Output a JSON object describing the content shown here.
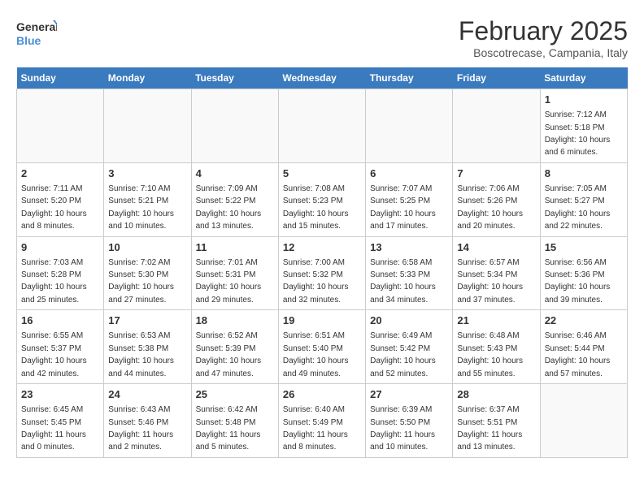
{
  "header": {
    "logo_line1": "General",
    "logo_line2": "Blue",
    "month": "February 2025",
    "location": "Boscotrecase, Campania, Italy"
  },
  "days_of_week": [
    "Sunday",
    "Monday",
    "Tuesday",
    "Wednesday",
    "Thursday",
    "Friday",
    "Saturday"
  ],
  "weeks": [
    [
      {
        "day": "",
        "info": ""
      },
      {
        "day": "",
        "info": ""
      },
      {
        "day": "",
        "info": ""
      },
      {
        "day": "",
        "info": ""
      },
      {
        "day": "",
        "info": ""
      },
      {
        "day": "",
        "info": ""
      },
      {
        "day": "1",
        "info": "Sunrise: 7:12 AM\nSunset: 5:18 PM\nDaylight: 10 hours\nand 6 minutes."
      }
    ],
    [
      {
        "day": "2",
        "info": "Sunrise: 7:11 AM\nSunset: 5:20 PM\nDaylight: 10 hours\nand 8 minutes."
      },
      {
        "day": "3",
        "info": "Sunrise: 7:10 AM\nSunset: 5:21 PM\nDaylight: 10 hours\nand 10 minutes."
      },
      {
        "day": "4",
        "info": "Sunrise: 7:09 AM\nSunset: 5:22 PM\nDaylight: 10 hours\nand 13 minutes."
      },
      {
        "day": "5",
        "info": "Sunrise: 7:08 AM\nSunset: 5:23 PM\nDaylight: 10 hours\nand 15 minutes."
      },
      {
        "day": "6",
        "info": "Sunrise: 7:07 AM\nSunset: 5:25 PM\nDaylight: 10 hours\nand 17 minutes."
      },
      {
        "day": "7",
        "info": "Sunrise: 7:06 AM\nSunset: 5:26 PM\nDaylight: 10 hours\nand 20 minutes."
      },
      {
        "day": "8",
        "info": "Sunrise: 7:05 AM\nSunset: 5:27 PM\nDaylight: 10 hours\nand 22 minutes."
      }
    ],
    [
      {
        "day": "9",
        "info": "Sunrise: 7:03 AM\nSunset: 5:28 PM\nDaylight: 10 hours\nand 25 minutes."
      },
      {
        "day": "10",
        "info": "Sunrise: 7:02 AM\nSunset: 5:30 PM\nDaylight: 10 hours\nand 27 minutes."
      },
      {
        "day": "11",
        "info": "Sunrise: 7:01 AM\nSunset: 5:31 PM\nDaylight: 10 hours\nand 29 minutes."
      },
      {
        "day": "12",
        "info": "Sunrise: 7:00 AM\nSunset: 5:32 PM\nDaylight: 10 hours\nand 32 minutes."
      },
      {
        "day": "13",
        "info": "Sunrise: 6:58 AM\nSunset: 5:33 PM\nDaylight: 10 hours\nand 34 minutes."
      },
      {
        "day": "14",
        "info": "Sunrise: 6:57 AM\nSunset: 5:34 PM\nDaylight: 10 hours\nand 37 minutes."
      },
      {
        "day": "15",
        "info": "Sunrise: 6:56 AM\nSunset: 5:36 PM\nDaylight: 10 hours\nand 39 minutes."
      }
    ],
    [
      {
        "day": "16",
        "info": "Sunrise: 6:55 AM\nSunset: 5:37 PM\nDaylight: 10 hours\nand 42 minutes."
      },
      {
        "day": "17",
        "info": "Sunrise: 6:53 AM\nSunset: 5:38 PM\nDaylight: 10 hours\nand 44 minutes."
      },
      {
        "day": "18",
        "info": "Sunrise: 6:52 AM\nSunset: 5:39 PM\nDaylight: 10 hours\nand 47 minutes."
      },
      {
        "day": "19",
        "info": "Sunrise: 6:51 AM\nSunset: 5:40 PM\nDaylight: 10 hours\nand 49 minutes."
      },
      {
        "day": "20",
        "info": "Sunrise: 6:49 AM\nSunset: 5:42 PM\nDaylight: 10 hours\nand 52 minutes."
      },
      {
        "day": "21",
        "info": "Sunrise: 6:48 AM\nSunset: 5:43 PM\nDaylight: 10 hours\nand 55 minutes."
      },
      {
        "day": "22",
        "info": "Sunrise: 6:46 AM\nSunset: 5:44 PM\nDaylight: 10 hours\nand 57 minutes."
      }
    ],
    [
      {
        "day": "23",
        "info": "Sunrise: 6:45 AM\nSunset: 5:45 PM\nDaylight: 11 hours\nand 0 minutes."
      },
      {
        "day": "24",
        "info": "Sunrise: 6:43 AM\nSunset: 5:46 PM\nDaylight: 11 hours\nand 2 minutes."
      },
      {
        "day": "25",
        "info": "Sunrise: 6:42 AM\nSunset: 5:48 PM\nDaylight: 11 hours\nand 5 minutes."
      },
      {
        "day": "26",
        "info": "Sunrise: 6:40 AM\nSunset: 5:49 PM\nDaylight: 11 hours\nand 8 minutes."
      },
      {
        "day": "27",
        "info": "Sunrise: 6:39 AM\nSunset: 5:50 PM\nDaylight: 11 hours\nand 10 minutes."
      },
      {
        "day": "28",
        "info": "Sunrise: 6:37 AM\nSunset: 5:51 PM\nDaylight: 11 hours\nand 13 minutes."
      },
      {
        "day": "",
        "info": ""
      }
    ]
  ]
}
